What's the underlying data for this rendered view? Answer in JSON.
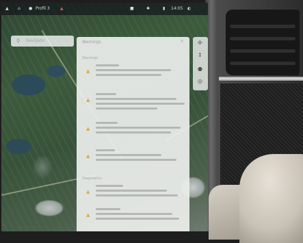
{
  "topbar": {
    "profile": "Profil 3",
    "time": "14:05"
  },
  "search": {
    "placeholder": "Navigate"
  },
  "panel": {
    "title": "Warnings",
    "sections": [
      "Warnings",
      "Diagnostics"
    ],
    "warnings_count": 6
  },
  "icons": {
    "warning": "warning-triangle-icon",
    "close": "close-icon",
    "compass": "compass-icon",
    "pin": "map-pin-icon",
    "layers": "layers-icon"
  },
  "colors": {
    "warning": "#e0a93a",
    "panel": "#eceeec"
  }
}
